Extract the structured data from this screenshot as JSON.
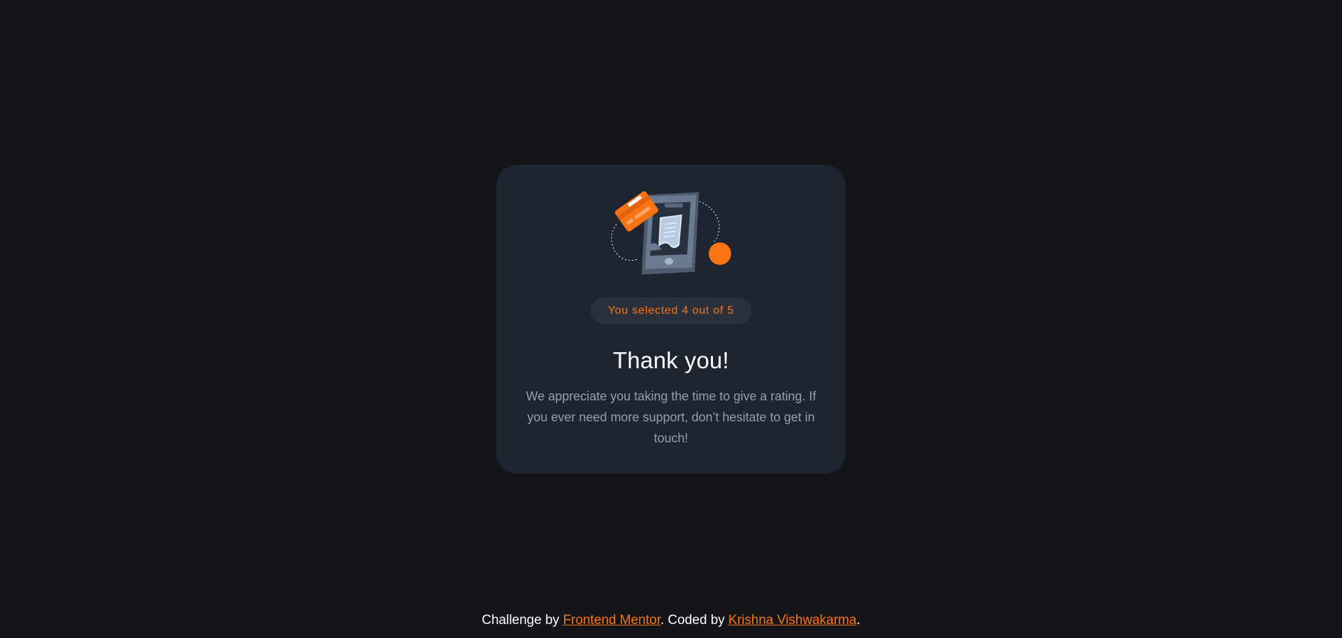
{
  "card": {
    "selection_text": "You selected 4 out of 5",
    "title": "Thank you!",
    "message": "We appreciate you taking the time to give a rating. If you ever need more support, don’t hesitate to get in touch!"
  },
  "attribution": {
    "prefix": "Challenge by ",
    "challenge_link": "Frontend Mentor",
    "middle": ". Coded by ",
    "author_link": "Krishna Vishwakarma",
    "suffix": "."
  },
  "colors": {
    "background": "#131518",
    "card": "#1f2530",
    "accent": "#fb7413",
    "muted_text": "#959eac"
  },
  "icons": {
    "illustration": "thank-you-phone-receipt-illustration"
  }
}
